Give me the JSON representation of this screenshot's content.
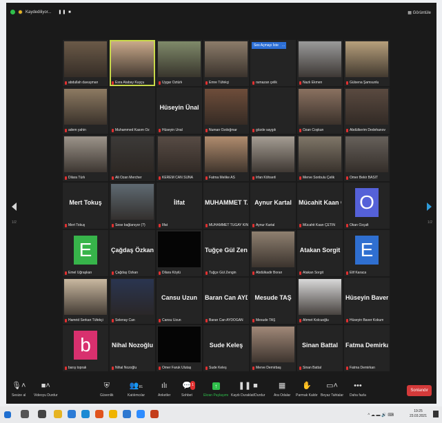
{
  "topbar": {
    "recording": "Kaydediliyor...",
    "pause": "❚❚ ■",
    "view": "Görüntüle"
  },
  "popup": {
    "label": "Ses Açmayı İste",
    "more": "..."
  },
  "pager": {
    "left": "1/2",
    "right": "1/2"
  },
  "tiles": [
    {
      "name": "abdullah davuşman",
      "type": "video",
      "bg": "#6b5a48"
    },
    {
      "name": "Esra Atabay Kuşçu",
      "type": "video",
      "bg": "#c9a98a",
      "active": true
    },
    {
      "name": "Uygar Öztürk",
      "type": "video",
      "bg": "#7f8a6a"
    },
    {
      "name": "Emre Tüfekçi",
      "type": "video",
      "bg": "#8c7c6a"
    },
    {
      "name": "ramazan çelik",
      "type": "blank"
    },
    {
      "name": "Nazlı Ekmen",
      "type": "video",
      "bg": "#9a9a9a"
    },
    {
      "name": "Gülsena Şamsunlu",
      "type": "video",
      "bg": "#b7a07c"
    },
    {
      "name": "adem yahin",
      "type": "video",
      "bg": "#8d7a62"
    },
    {
      "name": "Muhammed Kasım Öz",
      "type": "blank"
    },
    {
      "name": "Hüseyin Ünal",
      "type": "name",
      "big": "Hüseyin Ünal"
    },
    {
      "name": "Numan Özdoğmar",
      "type": "video",
      "bg": "#6e4d3a"
    },
    {
      "name": "gözde saygılı",
      "type": "blank"
    },
    {
      "name": "Ozan Coşkun",
      "type": "video",
      "bg": "#8a7160"
    },
    {
      "name": "Abdülkerim Dedehanov",
      "type": "video",
      "bg": "#5a4a40"
    },
    {
      "name": "Dilara Türk",
      "type": "video",
      "bg": "#9c948a"
    },
    {
      "name": "Ali Ozan Mercher",
      "type": "video",
      "bg": "#3c3a38"
    },
    {
      "name": "KEREM CAN SUNA",
      "type": "video",
      "bg": "#574b44"
    },
    {
      "name": "Fatma Melike AS",
      "type": "video",
      "bg": "#b08c6e"
    },
    {
      "name": "İrfan Köhserli",
      "type": "video",
      "bg": "#a59d93"
    },
    {
      "name": "Merve Sonbulu Çelik",
      "type": "video",
      "bg": "#7f7668"
    },
    {
      "name": "Ömer Bekir BASIT",
      "type": "video",
      "bg": "#66605a"
    },
    {
      "name": "Mert Tokuş",
      "type": "name",
      "big": "Mert Tokuş"
    },
    {
      "name": "Sese bağlanıyor (?)",
      "type": "video",
      "bg": "#5f6a72"
    },
    {
      "name": "İlfat",
      "type": "name",
      "big": "İlfat"
    },
    {
      "name": "MUHAMMET TUGAY KINAŞ",
      "type": "name",
      "big": "MUHAMMET T..."
    },
    {
      "name": "Aynur Kartal",
      "type": "name",
      "big": "Aynur Kartal"
    },
    {
      "name": "Mücahit Kaan ÇETİN",
      "type": "name",
      "big": "Mücahit Kaan Ç..."
    },
    {
      "name": "Okan Özçalt",
      "type": "avatar",
      "letter": "O",
      "color": "#5561d8"
    },
    {
      "name": "Emel Uğraşkan",
      "type": "avatar",
      "letter": "E",
      "color": "#37b44a"
    },
    {
      "name": "Çağdaş Özkan",
      "type": "name",
      "big": "Çağdaş Özkan"
    },
    {
      "name": "Dilara Köylü",
      "type": "dark"
    },
    {
      "name": "Tuğçe Gül Zengin",
      "type": "name",
      "big": "Tuğçe Gül Zengin"
    },
    {
      "name": "Abdülkadir Boran",
      "type": "video",
      "bg": "#8f8070"
    },
    {
      "name": "Atakan Sorgit",
      "type": "name",
      "big": "Atakan Sorgit"
    },
    {
      "name": "Elif Karaca",
      "type": "avatar",
      "letter": "E",
      "color": "#2f6fd0"
    },
    {
      "name": "Hamrid Serkan Tüfekçi",
      "type": "video",
      "bg": "#c9b8a0"
    },
    {
      "name": "Selenay Can",
      "type": "video",
      "bg": "#2a3550"
    },
    {
      "name": "Cansu Uzun",
      "type": "name",
      "big": "Cansu Uzun"
    },
    {
      "name": "Baran Can AYDOĞAN",
      "type": "name",
      "big": "Baran Can AYD..."
    },
    {
      "name": "Mesude TAŞ",
      "type": "name",
      "big": "Mesude TAŞ"
    },
    {
      "name": "Ahmet Kolcuoğlu",
      "type": "video",
      "bg": "#d8d8d8"
    },
    {
      "name": "Hüseyin Baver Kokum",
      "type": "name",
      "big": "Hüseyin Baver K..."
    },
    {
      "name": "barış toprak",
      "type": "avatar",
      "letter": "b",
      "color": "#d8306e"
    },
    {
      "name": "Nihal Nozoğlu",
      "type": "name",
      "big": "Nihal Nozoğlu"
    },
    {
      "name": "Ömer Faruk Ulutaş",
      "type": "dark"
    },
    {
      "name": "Sude Keleş",
      "type": "name",
      "big": "Sude Keleş"
    },
    {
      "name": "Merve Demirbaş",
      "type": "video",
      "bg": "#a08878"
    },
    {
      "name": "Sinan Battal",
      "type": "name",
      "big": "Sinan Battal"
    },
    {
      "name": "Fatma Demirkan",
      "type": "name",
      "big": "Fatma Demirkan"
    }
  ],
  "toolbar": {
    "mute": "Sesize al",
    "video": "Videoyu Durdur",
    "security": "Güvenlik",
    "participants": "Katılımcılar",
    "participants_count": "81",
    "polls": "Anketler",
    "chat": "Sohbet",
    "chat_badge": "1",
    "share": "Ekran Paylaşımı",
    "record": "Kaydı Duraklat/Durdur",
    "rooms": "Ara Odalar",
    "raise": "Parmak Kaldır",
    "whiteboard": "Beyaz Tahtalar",
    "more": "Daha fazla",
    "end": "Sonlandır"
  },
  "taskbar": {
    "time": "19:25",
    "date": "23.03.2021"
  }
}
